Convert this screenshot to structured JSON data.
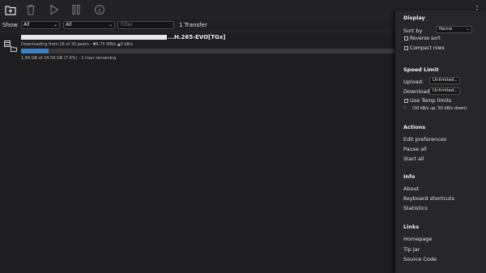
{
  "toolbar": {
    "buttons": [
      {
        "icon": "add-folder-icon",
        "interactable": true
      },
      {
        "icon": "trash-icon",
        "interactable": true
      },
      {
        "icon": "play-icon",
        "interactable": true
      },
      {
        "icon": "pause-icon",
        "interactable": true
      },
      {
        "icon": "info-icon",
        "interactable": true
      }
    ],
    "menu_glyph": "⋮"
  },
  "filter_bar": {
    "show_label": "Show",
    "status_filter": "All",
    "tracker_filter": "All",
    "filter_placeholder": "Filter",
    "transfer_count": "1 Transfer"
  },
  "torrent": {
    "name_visible_tail": "...H.265-EVO[TGx]",
    "peers": "Downloading from 16 of 30 peers - ▼6.75 MB/s ▲0 kB/s",
    "progress_fraction": 0.074,
    "eta": "1.84 GB of 24.59 GB (7.4%) - 1 hour remaining"
  },
  "panel": {
    "display": {
      "title": "Display",
      "sort_by_label": "Sort by",
      "sort_by_value": "Name",
      "reverse_sort": "Reverse sort",
      "compact_rows": "Compact rows"
    },
    "speed_limit": {
      "title": "Speed Limit",
      "upload_label": "Upload:",
      "upload_value": "Unlimited",
      "download_label": "Download:",
      "download_value": "Unlimited",
      "temp_limits": "Use Temp limits",
      "temp_info": "(50 kB/s up, 50 kB/s down)"
    },
    "actions": {
      "title": "Actions",
      "items": [
        "Edit preferences",
        "Pause all",
        "Start all"
      ]
    },
    "info": {
      "title": "Info",
      "items": [
        "About",
        "Keyboard shortcuts",
        "Statistics"
      ]
    },
    "links": {
      "title": "Links",
      "items": [
        "Homepage",
        "Tip Jar",
        "Source Code"
      ]
    }
  },
  "cut_text": "s",
  "colors": {
    "background": "#1e1e20",
    "toolbar": "#232325",
    "panel": "#27272a",
    "progress": "#3f7fc1"
  }
}
